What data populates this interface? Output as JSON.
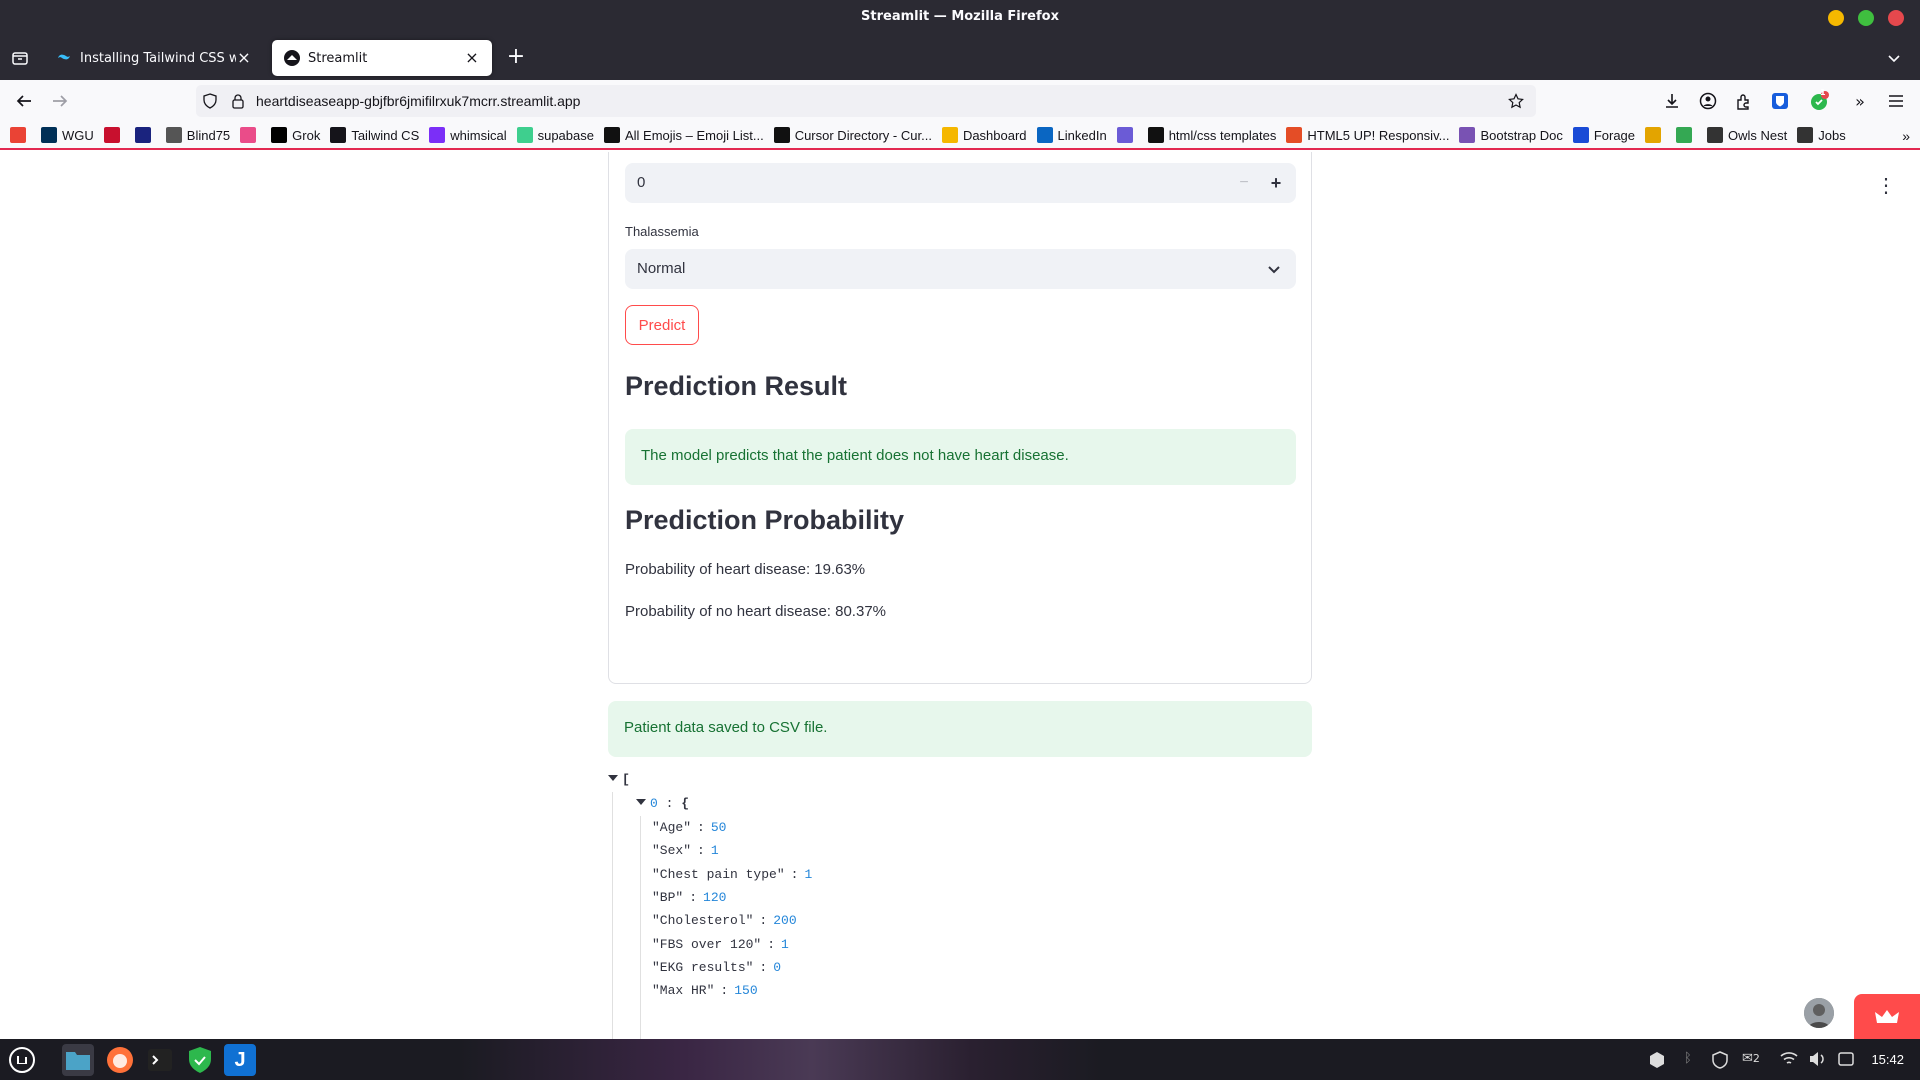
{
  "window": {
    "title": "Streamlit — Mozilla Firefox"
  },
  "tabs": [
    {
      "label": "Installing Tailwind CSS with",
      "active": false
    },
    {
      "label": "Streamlit",
      "active": true
    }
  ],
  "navbar": {
    "url": "heartdiseaseapp-gbjfbr6jmifilrxuk7mcrr.streamlit.app",
    "extension_badge": "1"
  },
  "bookmarks": [
    {
      "label": "",
      "icon": "gmail-icon",
      "color": "#ea4335"
    },
    {
      "label": "WGU",
      "icon": "wgu-icon",
      "color": "#003057"
    },
    {
      "label": "",
      "icon": "pi-icon",
      "color": "#c8102e"
    },
    {
      "label": "",
      "icon": "app-icon",
      "color": "#1a237e"
    },
    {
      "label": "Blind75",
      "icon": "blind-icon",
      "color": "#555555"
    },
    {
      "label": "",
      "icon": "dribbble-icon",
      "color": "#ea4c89"
    },
    {
      "label": "Grok",
      "icon": "grok-icon",
      "color": "#000000"
    },
    {
      "label": "Tailwind CS",
      "icon": "search-icon",
      "color": "#15141a"
    },
    {
      "label": "whimsical",
      "icon": "whimsical-icon",
      "color": "#7b2ff7"
    },
    {
      "label": "supabase",
      "icon": "supabase-icon",
      "color": "#3ecf8e"
    },
    {
      "label": "All Emojis – Emoji List...",
      "icon": "emoji-icon",
      "color": "#111111"
    },
    {
      "label": "Cursor Directory - Cur...",
      "icon": "cursor-icon",
      "color": "#111111"
    },
    {
      "label": "Dashboard",
      "icon": "smiley-icon",
      "color": "#f5b700"
    },
    {
      "label": "LinkedIn",
      "icon": "linkedin-icon",
      "color": "#0a66c2"
    },
    {
      "label": "",
      "icon": "bird-icon",
      "color": "#6b5bd6"
    },
    {
      "label": "html/css templates",
      "icon": "github-icon",
      "color": "#111111"
    },
    {
      "label": "HTML5 UP! Responsiv...",
      "icon": "html5up-icon",
      "color": "#e44d26"
    },
    {
      "label": "Bootstrap Doc",
      "icon": "bootstrap-icon",
      "color": "#7952b3"
    },
    {
      "label": "Forage",
      "icon": "forage-icon",
      "color": "#1a4bd6"
    },
    {
      "label": "",
      "icon": "chrome-icon",
      "color": "#e3a400"
    },
    {
      "label": "",
      "icon": "drive-icon",
      "color": "#34a853"
    },
    {
      "label": "Owls Nest",
      "icon": "owl-icon",
      "color": "#333333"
    },
    {
      "label": "Jobs",
      "icon": "jobs-icon",
      "color": "#333333"
    }
  ],
  "form": {
    "number_value": "0",
    "minus": "−",
    "plus": "+",
    "thalassemia_label": "Thalassemia",
    "thalassemia_value": "Normal",
    "predict_label": "Predict"
  },
  "result": {
    "heading": "Prediction Result",
    "message": "The model predicts that the patient does not have heart disease.",
    "prob_heading": "Prediction Probability",
    "prob_disease": "Probability of heart disease: 19.63%",
    "prob_no_disease": "Probability of no heart disease: 80.37%"
  },
  "saved_message": "Patient data saved to CSV file.",
  "json_view": {
    "open_bracket": "[",
    "index": "0",
    "index_sep": ":",
    "open_brace": "{",
    "entries": [
      {
        "key": "\"Age\"",
        "value": "50"
      },
      {
        "key": "\"Sex\"",
        "value": "1"
      },
      {
        "key": "\"Chest pain type\"",
        "value": "1"
      },
      {
        "key": "\"BP\"",
        "value": "120"
      },
      {
        "key": "\"Cholesterol\"",
        "value": "200"
      },
      {
        "key": "\"FBS over 120\"",
        "value": "1"
      },
      {
        "key": "\"EKG results\"",
        "value": "0"
      },
      {
        "key": "\"Max HR\"",
        "value": "150"
      }
    ]
  },
  "taskbar": {
    "clock": "15:42",
    "notifications": "2"
  }
}
